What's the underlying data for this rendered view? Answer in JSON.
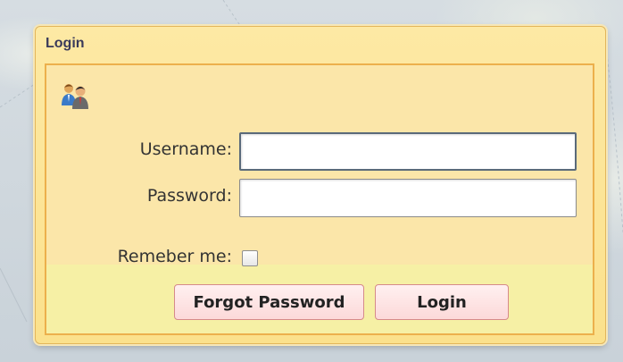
{
  "window": {
    "title": "Login"
  },
  "form": {
    "username_label": "Username:",
    "username_value": "",
    "password_label": "Password:",
    "password_value": "",
    "remember_label": "Remeber me:",
    "remember_checked": false
  },
  "buttons": {
    "forgot_label": "Forgot Password",
    "login_label": "Login"
  },
  "icons": {
    "header_icon": "users-icon"
  },
  "colors": {
    "window_bg": "#fbe18c",
    "panel_border": "#ecb04c",
    "footer_bg": "#f6f0a5",
    "button_bg": "#fcd9d9",
    "title_text": "#3a3a5a"
  }
}
